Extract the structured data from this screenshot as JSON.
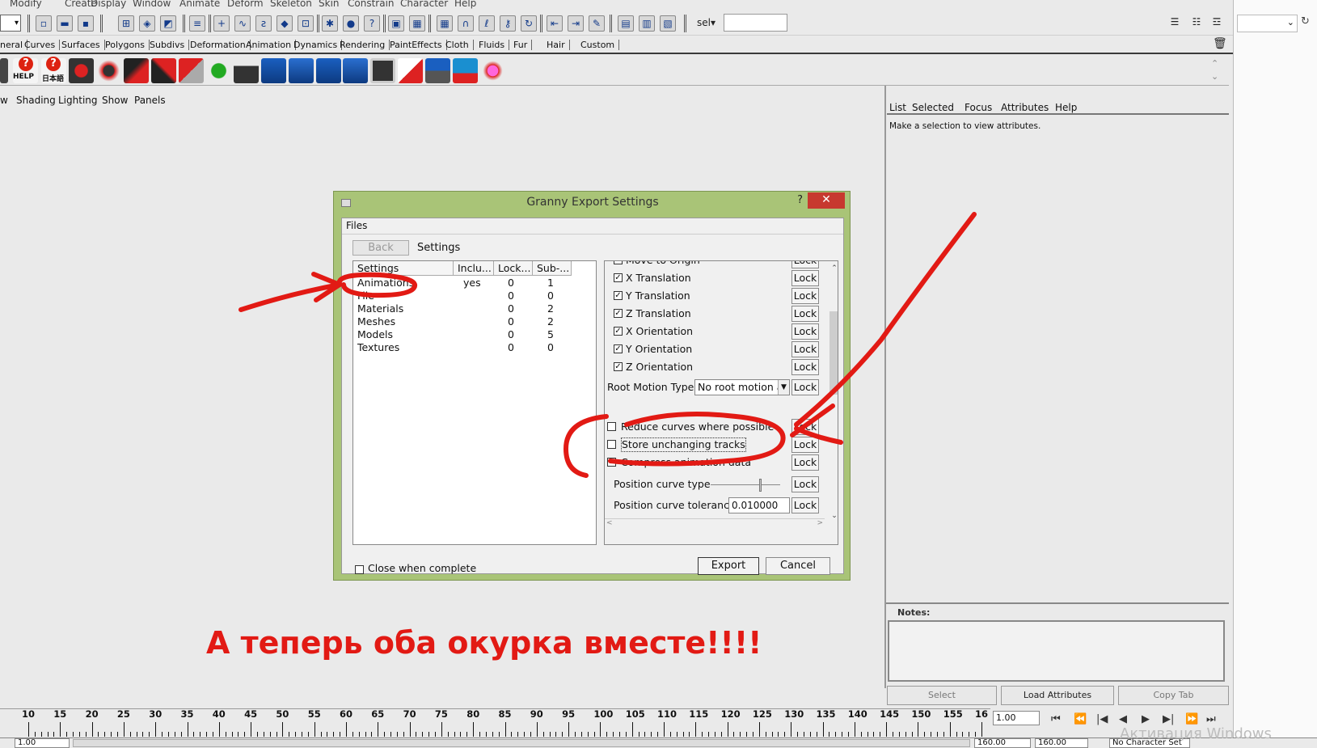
{
  "menu": [
    "Modify",
    "Create",
    "Display",
    "Window",
    "Animate",
    "Deform",
    "Skeleton",
    "Skin",
    "Constrain",
    "Character",
    "Help"
  ],
  "toolbar": {
    "sel_label": "sel▾",
    "sel_value": ""
  },
  "shelf_tabs": [
    "neral",
    "Curves",
    "Surfaces",
    "Polygons",
    "Subdivs",
    "Deformation",
    "Animation",
    "Dynamics",
    "Rendering",
    "PaintEffects",
    "Cloth",
    "Fluids",
    "Fur",
    "Hair",
    "Custom"
  ],
  "shelf": {
    "help_label": "HELP",
    "jp_label": "日本語"
  },
  "panel_menu": [
    "w",
    "Shading",
    "Lighting",
    "Show",
    "Panels"
  ],
  "attribute_editor": {
    "menu": [
      "List",
      "Selected",
      "Focus",
      "Attributes",
      "Help"
    ],
    "message": "Make a selection to view attributes.",
    "notes_label": "Notes:",
    "buttons": [
      "Select",
      "Load Attributes",
      "Copy Tab"
    ]
  },
  "dialog": {
    "title": "Granny Export Settings",
    "help": "?",
    "close": "✕",
    "files_menu": "Files",
    "back_button": "Back",
    "settings_tab": "Settings",
    "list_headers": [
      "Settings",
      "Inclu...",
      "Lock...",
      "Sub-..."
    ],
    "list_rows": [
      {
        "name": "Animations",
        "incl": "yes",
        "lock": "0",
        "sub": "1"
      },
      {
        "name": "File",
        "incl": "",
        "lock": "0",
        "sub": "0"
      },
      {
        "name": "Materials",
        "incl": "",
        "lock": "0",
        "sub": "2"
      },
      {
        "name": "Meshes",
        "incl": "",
        "lock": "0",
        "sub": "2"
      },
      {
        "name": "Models",
        "incl": "",
        "lock": "0",
        "sub": "5"
      },
      {
        "name": "Textures",
        "incl": "",
        "lock": "0",
        "sub": "0"
      }
    ],
    "options": [
      {
        "label": "Move to Origin",
        "checked": true
      },
      {
        "label": "X Translation",
        "checked": true
      },
      {
        "label": "Y Translation",
        "checked": true
      },
      {
        "label": "Z Translation",
        "checked": true
      },
      {
        "label": "X Orientation",
        "checked": true
      },
      {
        "label": "Y Orientation",
        "checked": true
      },
      {
        "label": "Z Orientation",
        "checked": true
      }
    ],
    "root_motion_label": "Root Motion Type",
    "root_motion_value": "No root motion a",
    "flags": [
      {
        "label": "Reduce curves where possible",
        "checked": false
      },
      {
        "label": "Store unchanging tracks",
        "checked": false
      },
      {
        "label": "Compress animation data",
        "checked": true
      }
    ],
    "position_curve_type_label": "Position curve type",
    "position_curve_tolerance_label": "Position curve tolerance",
    "position_curve_tolerance_value": "0.010000",
    "lock_label": "Lock",
    "close_when_complete": "Close when complete",
    "export_button": "Export",
    "cancel_button": "Cancel"
  },
  "caption": "А теперь оба окурка вместе!!!!",
  "timeline": {
    "labels": [
      "10",
      "15",
      "20",
      "25",
      "30",
      "35",
      "40",
      "45",
      "50",
      "55",
      "60",
      "65",
      "70",
      "75",
      "80",
      "85",
      "90",
      "95",
      "100",
      "105",
      "110",
      "115",
      "120",
      "125",
      "130",
      "135",
      "140",
      "145",
      "150",
      "155",
      "16"
    ],
    "current_frame": "1.00",
    "start_field": "1.00",
    "end_field_1": "160.00",
    "end_field_2": "160.00",
    "character_set": "No Character Set"
  },
  "watermark": "Активация Windows",
  "colors": {
    "annotation": "#e21a14",
    "dialog_frame": "#a9c477",
    "close_button": "#c7392f"
  }
}
